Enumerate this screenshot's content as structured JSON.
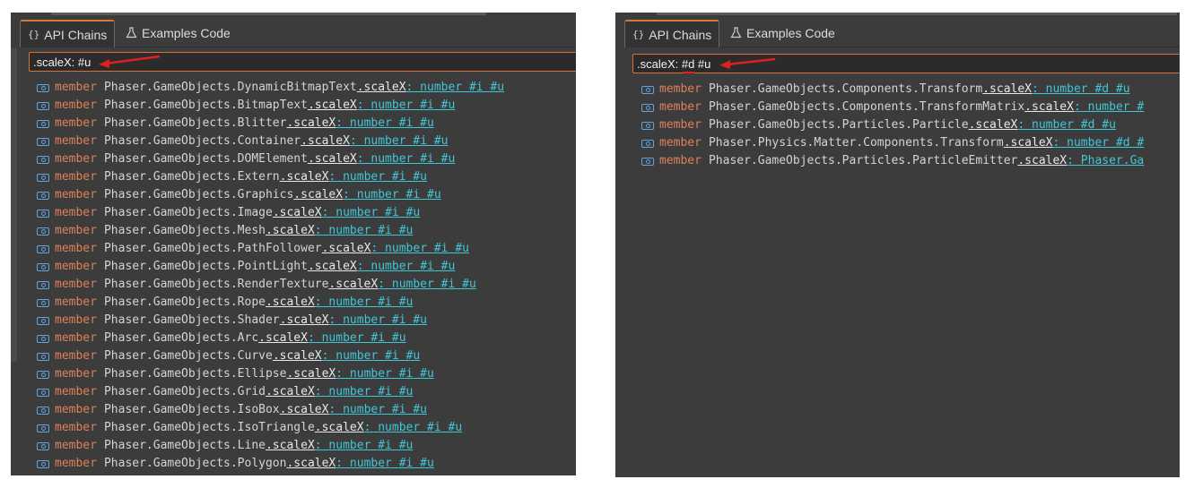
{
  "left": {
    "tabs": [
      {
        "icon": "{}",
        "label": "API Chains"
      },
      {
        "icon": "flask-icon",
        "label": "Examples Code"
      }
    ],
    "search_value": ".scaleX: #u",
    "keyword": "member",
    "results": [
      {
        "path": "Phaser.GameObjects.DynamicBitmapText",
        "prop": ".scaleX",
        "type": ": number #i #u"
      },
      {
        "path": "Phaser.GameObjects.BitmapText",
        "prop": ".scaleX",
        "type": ": number #i #u"
      },
      {
        "path": "Phaser.GameObjects.Blitter",
        "prop": ".scaleX",
        "type": ": number #i #u"
      },
      {
        "path": "Phaser.GameObjects.Container",
        "prop": ".scaleX",
        "type": ": number #i #u"
      },
      {
        "path": "Phaser.GameObjects.DOMElement",
        "prop": ".scaleX",
        "type": ": number #i #u"
      },
      {
        "path": "Phaser.GameObjects.Extern",
        "prop": ".scaleX",
        "type": ": number #i #u"
      },
      {
        "path": "Phaser.GameObjects.Graphics",
        "prop": ".scaleX",
        "type": ": number #i #u"
      },
      {
        "path": "Phaser.GameObjects.Image",
        "prop": ".scaleX",
        "type": ": number #i #u"
      },
      {
        "path": "Phaser.GameObjects.Mesh",
        "prop": ".scaleX",
        "type": ": number #i #u"
      },
      {
        "path": "Phaser.GameObjects.PathFollower",
        "prop": ".scaleX",
        "type": ": number #i #u"
      },
      {
        "path": "Phaser.GameObjects.PointLight",
        "prop": ".scaleX",
        "type": ": number #i #u"
      },
      {
        "path": "Phaser.GameObjects.RenderTexture",
        "prop": ".scaleX",
        "type": ": number #i #u"
      },
      {
        "path": "Phaser.GameObjects.Rope",
        "prop": ".scaleX",
        "type": ": number #i #u"
      },
      {
        "path": "Phaser.GameObjects.Shader",
        "prop": ".scaleX",
        "type": ": number #i #u"
      },
      {
        "path": "Phaser.GameObjects.Arc",
        "prop": ".scaleX",
        "type": ": number #i #u"
      },
      {
        "path": "Phaser.GameObjects.Curve",
        "prop": ".scaleX",
        "type": ": number #i #u"
      },
      {
        "path": "Phaser.GameObjects.Ellipse",
        "prop": ".scaleX",
        "type": ": number #i #u"
      },
      {
        "path": "Phaser.GameObjects.Grid",
        "prop": ".scaleX",
        "type": ": number #i #u"
      },
      {
        "path": "Phaser.GameObjects.IsoBox",
        "prop": ".scaleX",
        "type": ": number #i #u"
      },
      {
        "path": "Phaser.GameObjects.IsoTriangle",
        "prop": ".scaleX",
        "type": ": number #i #u"
      },
      {
        "path": "Phaser.GameObjects.Line",
        "prop": ".scaleX",
        "type": ": number #i #u"
      },
      {
        "path": "Phaser.GameObjects.Polygon",
        "prop": ".scaleX",
        "type": ": number #i #u"
      }
    ]
  },
  "right": {
    "tabs": [
      {
        "icon": "{}",
        "label": "API Chains"
      },
      {
        "icon": "flask-icon",
        "label": "Examples Code"
      }
    ],
    "search_value": ".scaleX: #d #u",
    "keyword": "member",
    "results": [
      {
        "path": "Phaser.GameObjects.Components.Transform",
        "prop": ".scaleX",
        "type": ": number #d #u"
      },
      {
        "path": "Phaser.GameObjects.Components.TransformMatrix",
        "prop": ".scaleX",
        "type": ": number #"
      },
      {
        "path": "Phaser.GameObjects.Particles.Particle",
        "prop": ".scaleX",
        "type": ": number #d #u"
      },
      {
        "path": "Phaser.Physics.Matter.Components.Transform",
        "prop": ".scaleX",
        "type": ": number #d #"
      },
      {
        "path": "Phaser.GameObjects.Particles.ParticleEmitter",
        "prop": ".scaleX",
        "type": ": Phaser.Ga"
      }
    ]
  },
  "colors": {
    "panel_bg": "#3c3c3c",
    "accent_orange": "#d8723a",
    "keyword": "#e0805a",
    "type_cyan": "#3fc7d8",
    "arrow_red": "#e02020"
  }
}
